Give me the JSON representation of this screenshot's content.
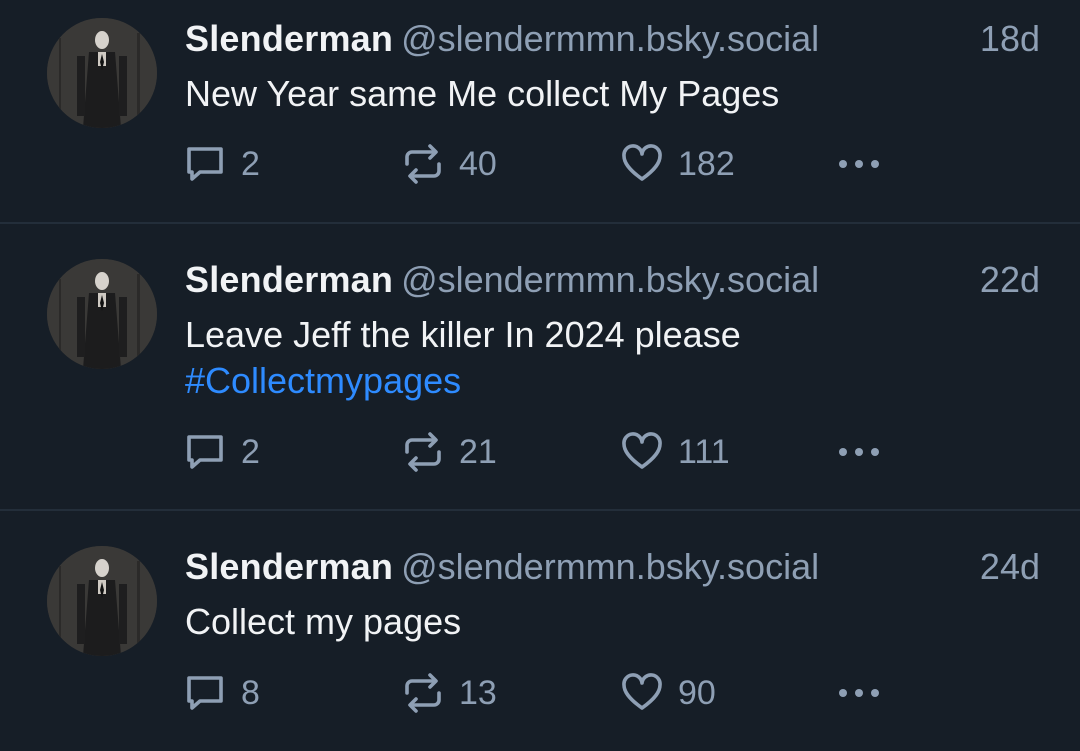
{
  "colors": {
    "background": "#161e27",
    "divider": "#232e3a",
    "name": "#f1f3f5",
    "muted": "#8e9fb4",
    "link": "#2e8bff"
  },
  "posts": [
    {
      "author_name": "Slenderman",
      "handle": "@slendermmn.bsky.social",
      "time": "18d",
      "text": "New Year same Me collect My Pages",
      "hashtag": "",
      "replies": "2",
      "reposts": "40",
      "likes": "182"
    },
    {
      "author_name": "Slenderman",
      "handle": "@slendermmn.bsky.social",
      "time": "22d",
      "text": "Leave Jeff the killer In 2024 please",
      "hashtag": "#Collectmypages",
      "replies": "2",
      "reposts": "21",
      "likes": "111"
    },
    {
      "author_name": "Slenderman",
      "handle": "@slendermmn.bsky.social",
      "time": "24d",
      "text": "Collect my pages",
      "hashtag": "",
      "replies": "8",
      "reposts": "13",
      "likes": "90"
    }
  ],
  "icons": {
    "reply": "reply-icon",
    "repost": "repost-icon",
    "like": "heart-icon",
    "more": "more-dots-icon"
  }
}
